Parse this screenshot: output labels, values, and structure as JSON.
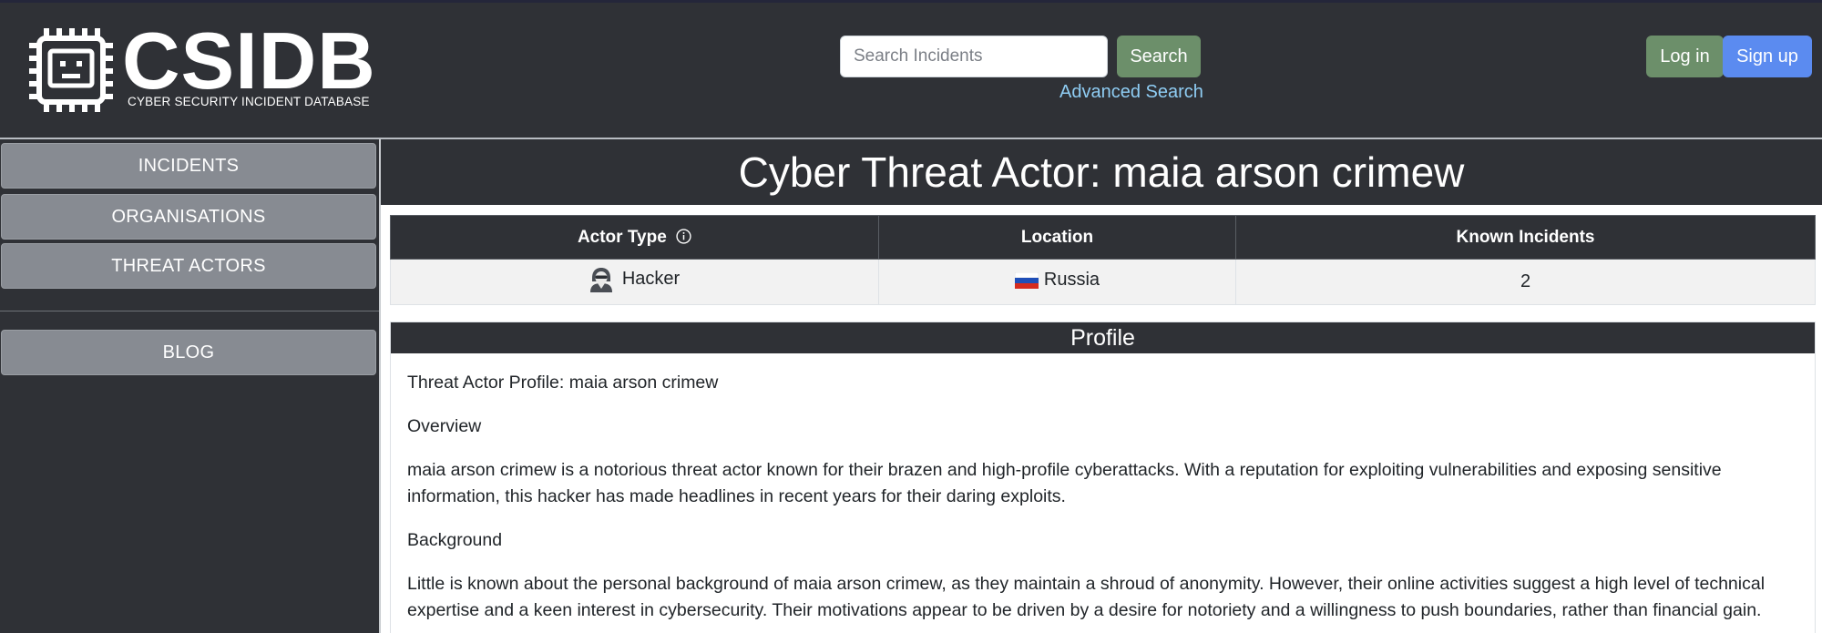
{
  "header": {
    "logo_text": "CSIDB",
    "logo_subtitle": "CYBER SECURITY INCIDENT DATABASE",
    "search_placeholder": "Search Incidents",
    "search_button": "Search",
    "advanced_search": "Advanced Search",
    "login_button": "Log in",
    "signup_button": "Sign up"
  },
  "sidebar": {
    "items": [
      {
        "label": "INCIDENTS"
      },
      {
        "label": "ORGANISATIONS"
      },
      {
        "label": "THREAT ACTORS"
      }
    ],
    "blog_label": "BLOG"
  },
  "main": {
    "title": "Cyber Threat Actor: maia arson crimew",
    "table": {
      "headers": [
        "Actor Type",
        "Location",
        "Known Incidents"
      ],
      "actor_type": "Hacker",
      "location": "Russia",
      "known_incidents": "2"
    },
    "profile": {
      "heading": "Profile",
      "paragraphs": [
        "Threat Actor Profile: maia arson crimew",
        "Overview",
        "maia arson crimew is a notorious threat actor known for their brazen and high-profile cyberattacks. With a reputation for exploiting vulnerabilities and exposing sensitive information, this hacker has made headlines in recent years for their daring exploits.",
        "Background",
        "Little is known about the personal background of maia arson crimew, as they maintain a shroud of anonymity. However, their online activities suggest a high level of technical expertise and a keen interest in cybersecurity. Their motivations appear to be driven by a desire for notoriety and a willingness to push boundaries, rather than financial gain."
      ]
    }
  },
  "colors": {
    "header_bg": "#2f3136",
    "search_green": "#6c8f6a",
    "signup_blue": "#5b8bf0",
    "link_blue": "#8fcdf4",
    "nav_gray": "#878b92"
  },
  "icons": {
    "logo": "chip-face-icon",
    "info": "info-circle-icon",
    "actor": "hacker-icon",
    "flag": "russia-flag-icon"
  }
}
